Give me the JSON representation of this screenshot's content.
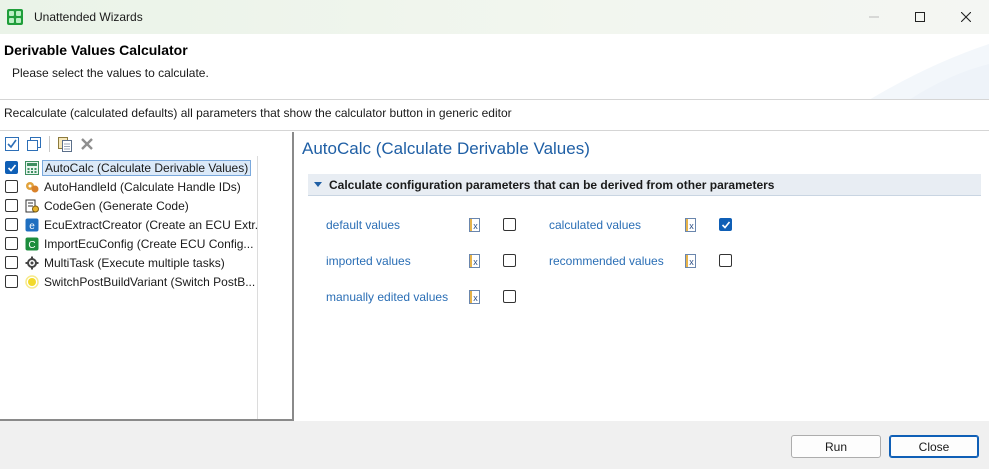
{
  "window": {
    "title": "Unattended Wizards"
  },
  "header": {
    "title": "Derivable Values Calculator",
    "subtitle": "Please select the values to calculate."
  },
  "description": "Recalculate (calculated defaults) all parameters that show the calculator button in generic editor",
  "toolbar": {
    "icons": [
      "check-all-icon",
      "uncheck-all-icon",
      "copy-icon",
      "delete-icon"
    ]
  },
  "tree": {
    "items": [
      {
        "label": "AutoCalc (Calculate Derivable Values)",
        "checked": true,
        "selected": true,
        "icon": "calculator-icon"
      },
      {
        "label": "AutoHandleId (Calculate Handle IDs)",
        "checked": false,
        "selected": false,
        "icon": "handle-id-icon"
      },
      {
        "label": "CodeGen (Generate Code)",
        "checked": false,
        "selected": false,
        "icon": "codegen-icon"
      },
      {
        "label": "EcuExtractCreator (Create an ECU Extr...",
        "checked": false,
        "selected": false,
        "icon": "ecu-extract-icon"
      },
      {
        "label": "ImportEcuConfig (Create ECU Config...",
        "checked": false,
        "selected": false,
        "icon": "import-ecu-icon"
      },
      {
        "label": "MultiTask (Execute multiple tasks)",
        "checked": false,
        "selected": false,
        "icon": "multitask-icon"
      },
      {
        "label": "SwitchPostBuildVariant (Switch PostB...",
        "checked": false,
        "selected": false,
        "icon": "switch-variant-icon"
      }
    ]
  },
  "detail": {
    "title": "AutoCalc (Calculate Derivable Values)",
    "section_label": "Calculate configuration parameters that can be derived from other parameters",
    "options": {
      "default_values": {
        "label": "default values",
        "checked": false
      },
      "calculated_values": {
        "label": "calculated values",
        "checked": true
      },
      "imported_values": {
        "label": "imported values",
        "checked": false
      },
      "recommended_values": {
        "label": "recommended values",
        "checked": false
      },
      "manually_edited_values": {
        "label": "manually edited values",
        "checked": false
      }
    }
  },
  "buttons": {
    "run": "Run",
    "close": "Close"
  },
  "colors": {
    "accent": "#0f5fb6",
    "link": "#2a6eb5",
    "title_blue": "#1f5fa5"
  }
}
